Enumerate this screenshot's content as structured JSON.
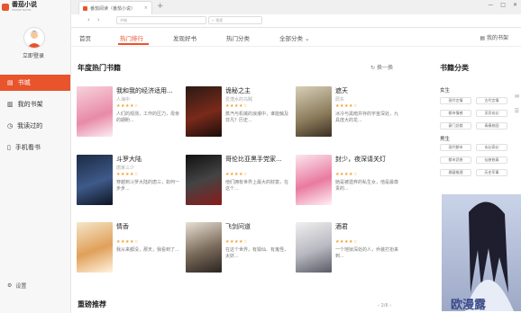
{
  "app": {
    "logo": "番茄小说",
    "logo_sub": "FANQIE NOVEL"
  },
  "window": {
    "tab_title": "番茄阅读（番茄小说）",
    "search_placeholder": "搜索",
    "url_text": "书城",
    "min": "—",
    "max": "□",
    "close": "✕"
  },
  "sidebar": {
    "login": "立即登录",
    "items": [
      {
        "label": "书城",
        "icon": "book-icon"
      },
      {
        "label": "我的书架",
        "icon": "shelf-icon"
      },
      {
        "label": "我读过的",
        "icon": "history-icon"
      },
      {
        "label": "手机看书",
        "icon": "phone-icon"
      }
    ],
    "settings": "设置"
  },
  "menu": {
    "items": [
      "首页",
      "热门排行",
      "发现好书",
      "热门分类",
      "全部分类 ⌄"
    ],
    "shelf": "我的书架"
  },
  "section": {
    "title": "年度热门书籍",
    "refresh": "换一换",
    "bottom_title": "重磅推荐",
    "pager": "2/6"
  },
  "books": [
    {
      "title": "我和我的经济适用...",
      "author": "人海中",
      "stars": "★★★★☆",
      "desc": "人们的观测，工作的压力，母亲的期盼..."
    },
    {
      "title": "诡秘之主",
      "author": "爱潜水的乌贼",
      "stars": "★★★★☆",
      "desc": "蒸汽与机械的浪潮中，谁能触及非凡？历史..."
    },
    {
      "title": "遮天",
      "author": "辰东",
      "stars": "★★★★☆",
      "desc": "冰冷与黑暗并存的宇宙深处，九具庞大的龙..."
    },
    {
      "title": "斗罗大陆",
      "author": "唐家三少",
      "stars": "★★★★☆",
      "desc": "穿越到斗罗大陆的唐三，如何一步步..."
    },
    {
      "title": "哥伦比亚黑手党家...",
      "author": "",
      "stars": "★★★★☆",
      "desc": "他们拥有世界上最大的财富，在这个..."
    },
    {
      "title": "封少，夜深请关灯",
      "author": "",
      "stars": "★★★★☆",
      "desc": "她是被遗弃的私生女，他是最尊贵的..."
    },
    {
      "title": "情香",
      "author": "",
      "stars": "★★★★☆",
      "desc": "我从来都没，那天，我看到了..."
    },
    {
      "title": "飞剑问道",
      "author": "",
      "stars": "★★★★☆",
      "desc": "在这个世界，有狐仙、有鬼怪，太妖..."
    },
    {
      "title": "酒君",
      "author": "",
      "stars": "★★★★☆",
      "desc": "一个地狱深处的人，乔装打扮来到..."
    }
  ],
  "categories": {
    "title": "书籍分类",
    "female": "女生",
    "female_items": [
      "现代言情",
      "古代言情",
      "都市情感",
      "灵异玄幻",
      "豪门总裁",
      "青春校园"
    ],
    "male": "男生",
    "male_items": [
      "现代都市",
      "玄幻奇幻",
      "都市武侠",
      "仙侠修真",
      "悬疑推理",
      "历史军事"
    ],
    "promo_text": "欧漫露"
  },
  "colors": {
    "accent": "#e8542c"
  }
}
